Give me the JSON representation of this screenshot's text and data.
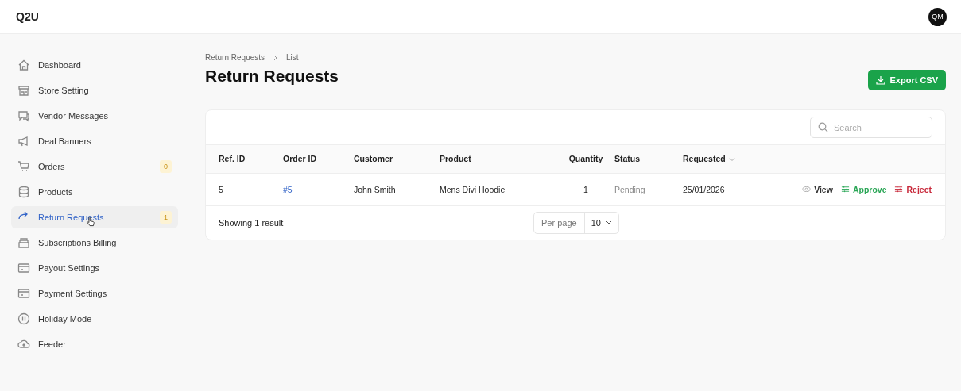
{
  "app": {
    "logo": "Q2U",
    "avatar": "QM"
  },
  "sidebar": {
    "items": [
      {
        "label": "Dashboard",
        "selected": false
      },
      {
        "label": "Store Setting",
        "selected": false
      },
      {
        "label": "Vendor Messages",
        "selected": false
      },
      {
        "label": "Deal Banners",
        "selected": false
      },
      {
        "label": "Orders",
        "selected": false,
        "badge": "0"
      },
      {
        "label": "Products",
        "selected": false
      },
      {
        "label": "Return Requests",
        "selected": true,
        "badge": "1"
      },
      {
        "label": "Subscriptions Billing",
        "selected": false
      },
      {
        "label": "Payout Settings",
        "selected": false
      },
      {
        "label": "Payment Settings",
        "selected": false
      },
      {
        "label": "Holiday Mode",
        "selected": false
      },
      {
        "label": "Feeder",
        "selected": false
      }
    ]
  },
  "breadcrumb": [
    "Return Requests",
    "List"
  ],
  "page_title": "Return Requests",
  "export_button": "Export CSV",
  "search": {
    "placeholder": "Search"
  },
  "table": {
    "columns": [
      {
        "label": "Ref. ID"
      },
      {
        "label": "Order ID"
      },
      {
        "label": "Customer"
      },
      {
        "label": "Product"
      },
      {
        "label": "Quantity"
      },
      {
        "label": "Status"
      },
      {
        "label": "Requested",
        "sortable": true
      }
    ],
    "rows": [
      {
        "cells": [
          "5",
          "#5",
          "John Smith",
          "Mens Divi Hoodie",
          "1",
          "Pending",
          "25/01/2026"
        ],
        "actions": [
          {
            "kind": "view",
            "label": "View"
          },
          {
            "kind": "approve",
            "label": "Approve"
          },
          {
            "kind": "reject",
            "label": "Reject"
          }
        ]
      }
    ]
  },
  "footer": {
    "summary": "Showing 1 result",
    "per_page_label": "Per page",
    "per_page": "10"
  }
}
